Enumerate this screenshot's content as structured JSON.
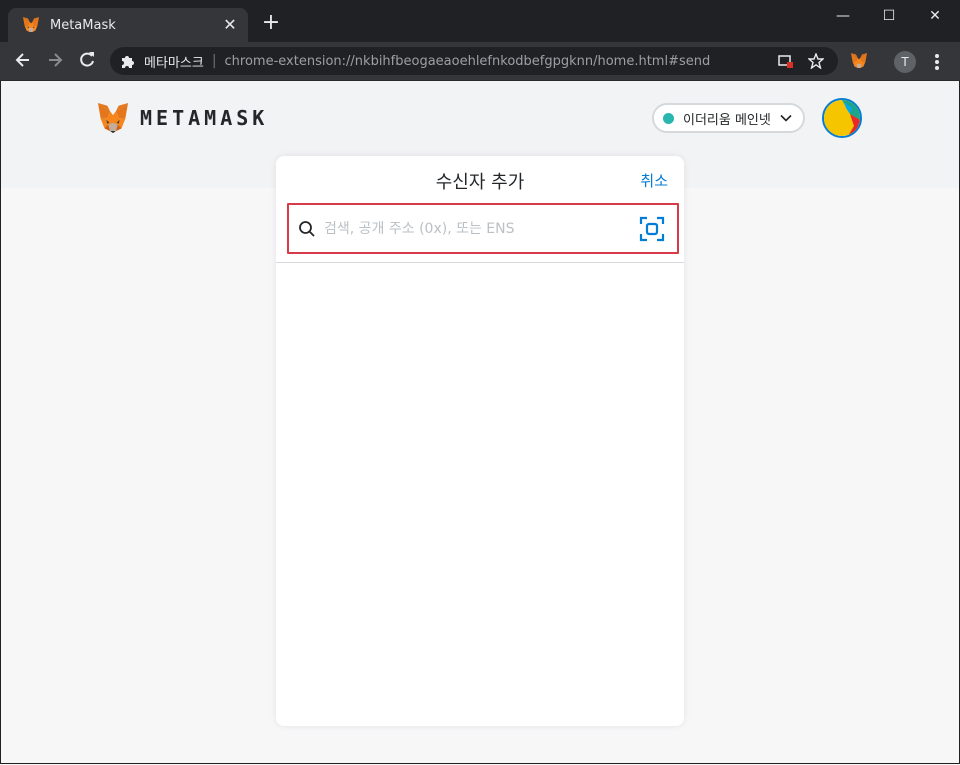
{
  "browser": {
    "tab_title": "MetaMask",
    "tab_close": "✕",
    "new_tab": "+",
    "window_min": "—",
    "window_max": "☐",
    "window_close": "✕",
    "omnibox_label": "메타마스크",
    "omnibox_separator": "|",
    "url": "chrome-extension://nkbihfbeogaeaoehlefnkodbefgpgknn/home.html#send",
    "profile_initial": "T",
    "icons": [
      "back-arrow-icon",
      "forward-arrow-icon",
      "reload-icon",
      "extension-puzzle-icon",
      "blocked-popup-icon",
      "star-icon",
      "metamask-fox-icon",
      "menu-dots-icon"
    ]
  },
  "app": {
    "logo_text": "METAMASK",
    "network": {
      "label": "이더리움 메인넷",
      "dot_color": "#29b6af"
    },
    "accent_color": "#037dd6"
  },
  "send": {
    "title": "수신자 추가",
    "cancel_label": "취소",
    "search_placeholder": "검색, 공개 주소 (0x), 또는 ENS",
    "search_value": "",
    "highlight_color": "#d73a49"
  }
}
